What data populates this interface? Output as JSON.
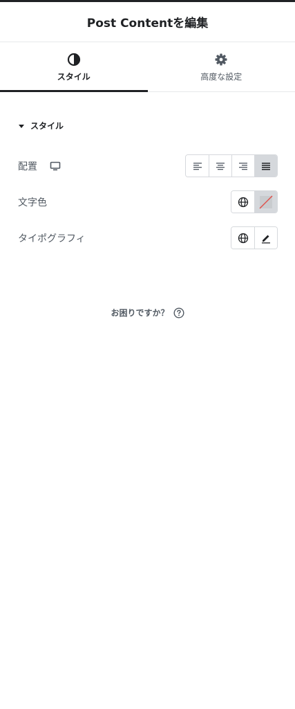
{
  "header": {
    "title": "Post Contentを編集"
  },
  "tabs": [
    {
      "label": "スタイル",
      "icon": "contrast-icon",
      "active": true
    },
    {
      "label": "高度な設定",
      "icon": "gear-icon",
      "active": false
    }
  ],
  "section": {
    "title": "スタイル",
    "icon": "caret-down-icon"
  },
  "controls": {
    "alignment": {
      "label": "配置",
      "device_icon": "desktop-icon",
      "options": [
        "align-left",
        "align-center",
        "align-right",
        "align-justify"
      ],
      "selected": "align-justify"
    },
    "text_color": {
      "label": "文字色",
      "global_icon": "globe-icon",
      "swatch": "unset-color-swatch"
    },
    "typography": {
      "label": "タイポグラフィ",
      "global_icon": "globe-icon",
      "edit_icon": "pencil-icon"
    }
  },
  "help": {
    "text": "お困りですか？",
    "icon": "question-circle-icon"
  },
  "colors": {
    "text_primary": "#1f2124",
    "text_secondary": "#515962",
    "border": "#d5d8dc",
    "selected_bg": "#d5d8dc",
    "unset_line": "#e0504a"
  }
}
